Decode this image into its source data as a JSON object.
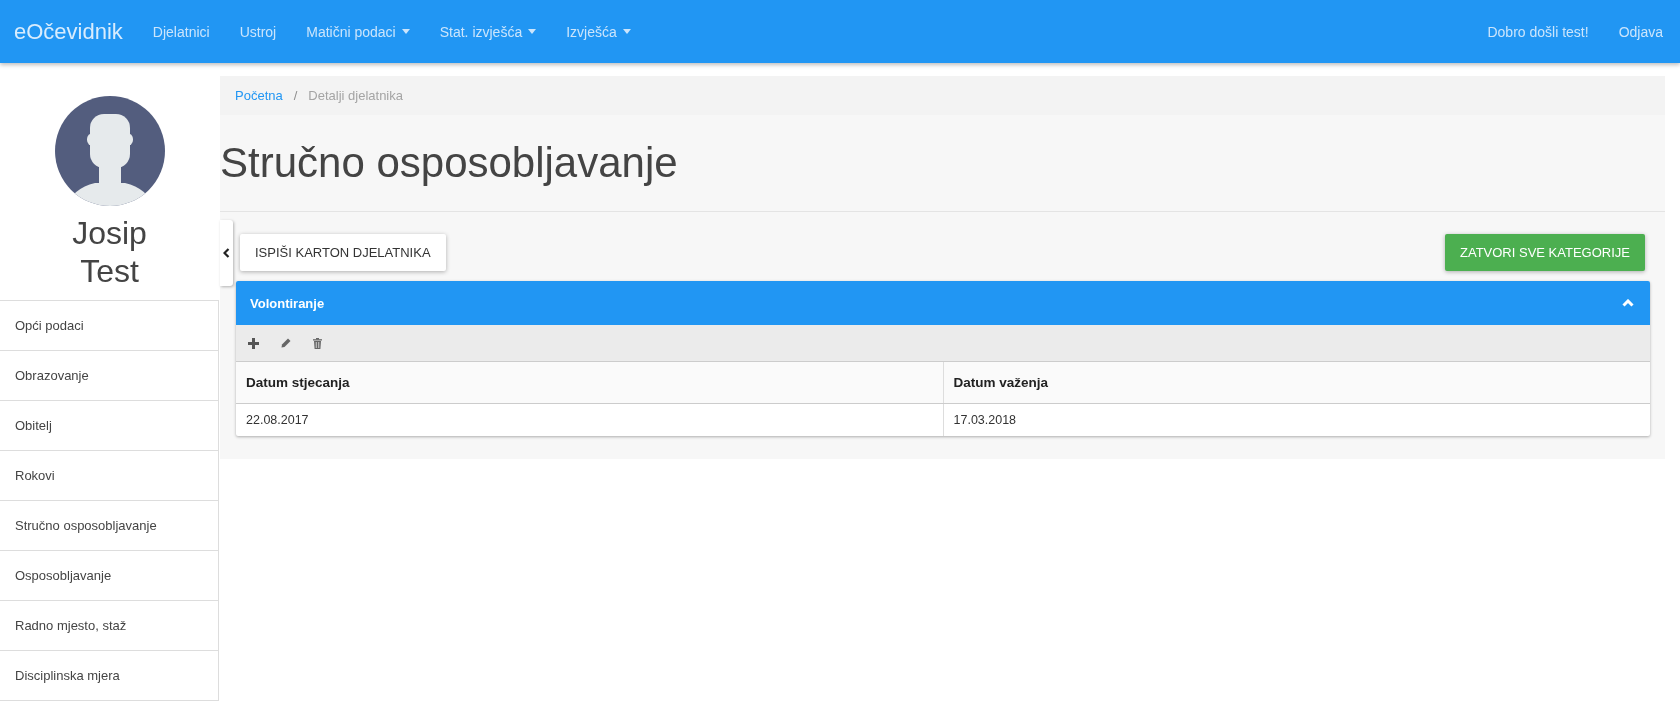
{
  "navbar": {
    "brand": "eOčevidnik",
    "links": [
      {
        "label": "Djelatnici",
        "dropdown": false
      },
      {
        "label": "Ustroj",
        "dropdown": false
      },
      {
        "label": "Matični podaci",
        "dropdown": true
      },
      {
        "label": "Stat. izvješća",
        "dropdown": true
      },
      {
        "label": "Izvješća",
        "dropdown": true
      }
    ],
    "greeting": "Dobro došli test!",
    "logout": "Odjava"
  },
  "sidebar": {
    "employee_name": "Josip Test",
    "items": [
      {
        "label": "Opći podaci",
        "selected": false
      },
      {
        "label": "Obrazovanje",
        "selected": false
      },
      {
        "label": "Obitelj",
        "selected": false
      },
      {
        "label": "Rokovi",
        "selected": false
      },
      {
        "label": "Stručno osposobljavanje",
        "selected": false
      },
      {
        "label": "Osposobljavanje",
        "selected": false
      },
      {
        "label": "Radno mjesto, staž",
        "selected": false
      },
      {
        "label": "Disciplinska mjera",
        "selected": false
      }
    ]
  },
  "breadcrumb": {
    "separator": "/",
    "items": [
      {
        "label": "Početna",
        "kind": "link"
      },
      {
        "label": "Detalji djelatnika",
        "kind": "current"
      }
    ]
  },
  "page_title": "Stručno osposobljavanje",
  "actions": {
    "print_button": "ISPIŠI KARTON DJELATNIKA",
    "collapse_all_button": "ZATVORI SVE KATEGORIJE"
  },
  "panel": {
    "title": "Volontiranje",
    "expanded": true,
    "table": {
      "columns": [
        "Datum stjecanja",
        "Datum važenja"
      ],
      "rows": [
        [
          "22.08.2017",
          "17.03.2018"
        ]
      ]
    }
  }
}
